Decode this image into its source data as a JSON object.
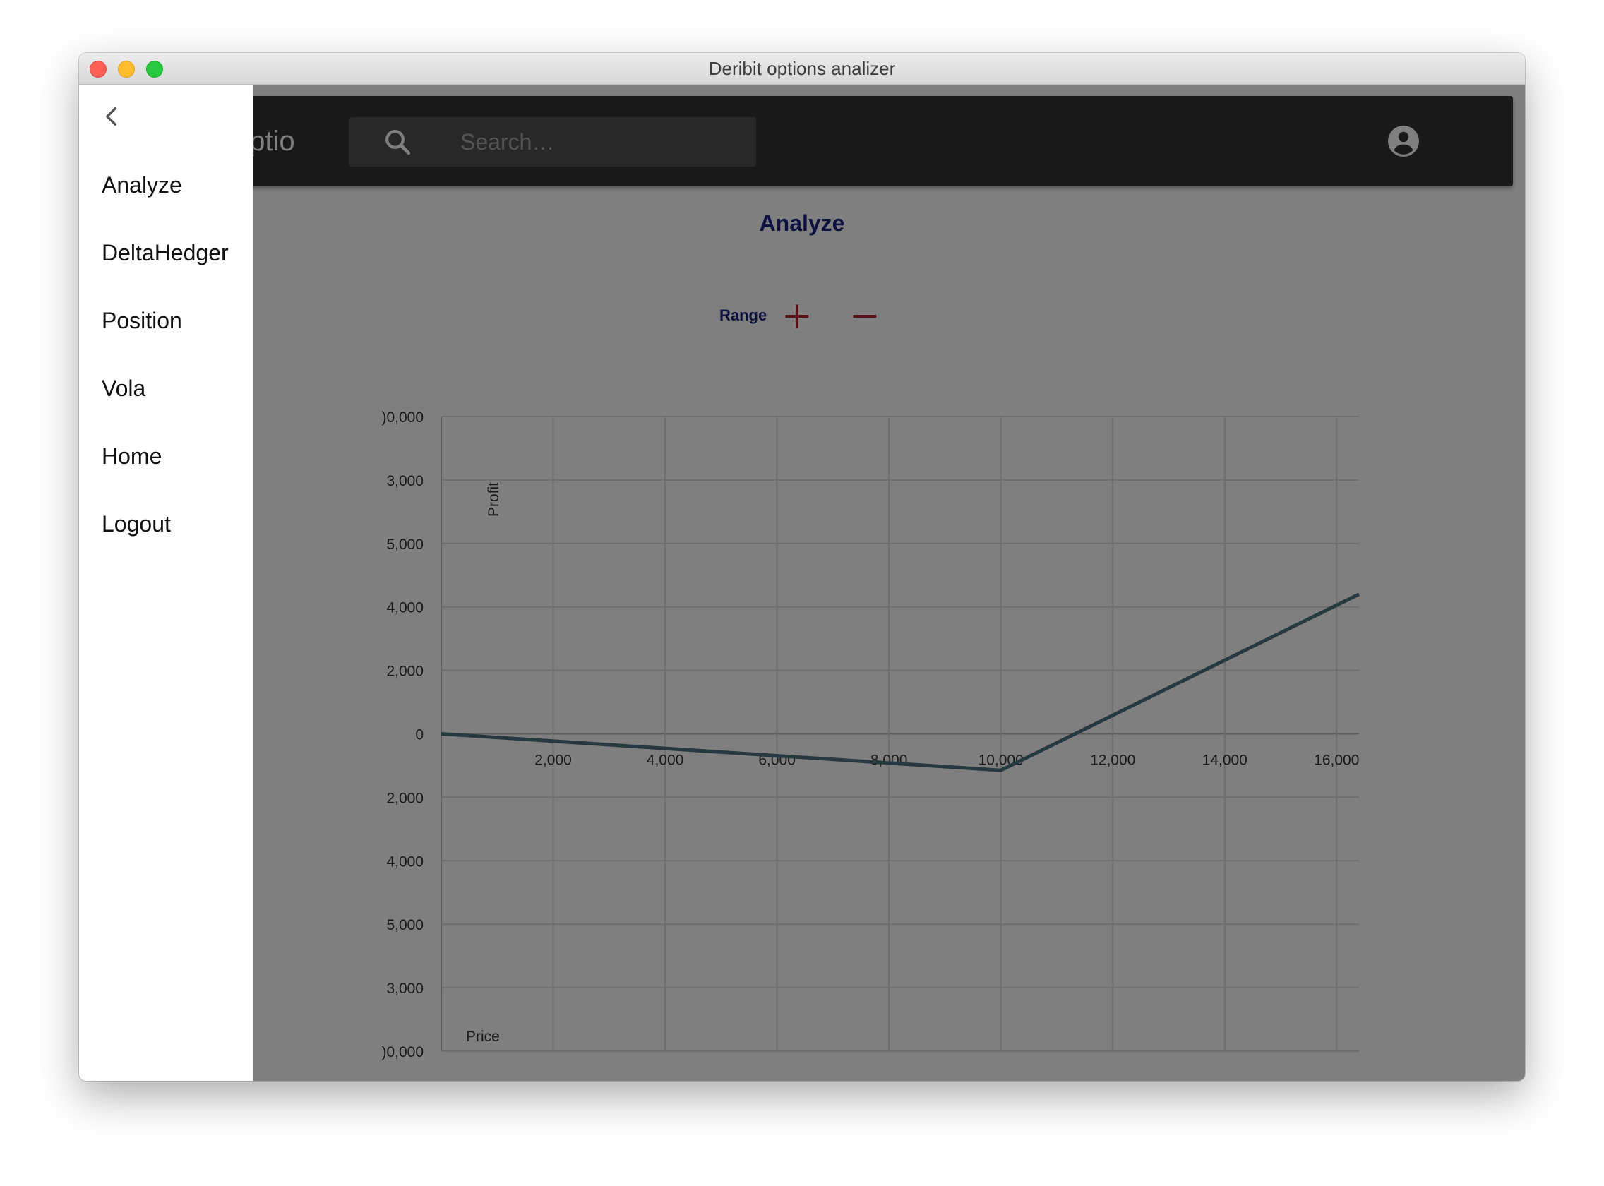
{
  "window": {
    "title": "Deribit options analizer"
  },
  "appbar": {
    "title": "Optio",
    "search_placeholder": "Search…",
    "icons": [
      "search-icon",
      "account-circle-icon"
    ]
  },
  "page": {
    "title": "Analyze"
  },
  "range_controls": {
    "label": "Range",
    "plus_icon": "plus-icon",
    "minus_icon": "minus-icon",
    "color": "#b0222e"
  },
  "drawer": {
    "back_icon": "chevron-left-icon",
    "items": [
      {
        "label": "Analyze"
      },
      {
        "label": "DeltaHedger"
      },
      {
        "label": "Position"
      },
      {
        "label": "Vola"
      },
      {
        "label": "Home"
      },
      {
        "label": "Logout"
      }
    ]
  },
  "chart_data": {
    "type": "line",
    "xlabel": "Price",
    "ylabel": "Profit",
    "xlim": [
      0,
      16400
    ],
    "ylim": [
      -10000,
      10000
    ],
    "x_ticks": [
      "2,000",
      "4,000",
      "6,000",
      "8,000",
      "10,000",
      "12,000",
      "14,000",
      "16,000"
    ],
    "y_ticks": [
      ")0,000",
      "3,000",
      "5,000",
      "4,000",
      "2,000",
      "0",
      "2,000",
      "4,000",
      "5,000",
      "3,000",
      ")0,000"
    ],
    "y_tick_values": [
      10000,
      8000,
      6000,
      4000,
      2000,
      0,
      -2000,
      -4000,
      -6000,
      -8000,
      -10000
    ],
    "grid": true,
    "series": [
      {
        "color": "#4f7380",
        "x": [
          0,
          10000,
          16400
        ],
        "y": [
          0,
          -1150,
          4400
        ]
      }
    ]
  },
  "colors": {
    "appbar": "#333333",
    "title_text": "#1a237e",
    "overlay": "rgba(0,0,0,0.5)"
  }
}
